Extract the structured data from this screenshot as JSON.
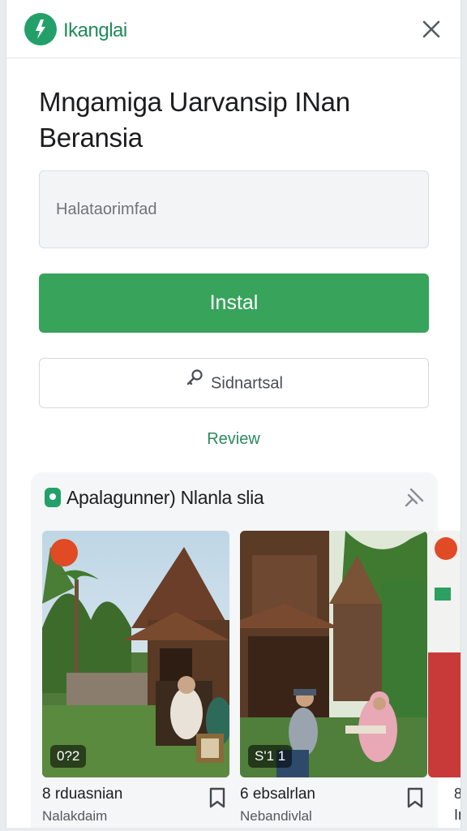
{
  "header": {
    "brand": "Ikanglai",
    "logo_icon": "brand-logo-icon",
    "close_icon": "close-icon"
  },
  "title": {
    "line1": "Mngamiga Uarvansip INan",
    "line2": "Beransia"
  },
  "search": {
    "placeholder": "Halataorimfad"
  },
  "actions": {
    "install_label": "Instal",
    "secondary_label": "Sidnartsal",
    "secondary_icon": "key-icon",
    "review_label": "Review"
  },
  "card": {
    "title": "Apalagunner) Nlanla slia",
    "pin_icon": "pin-icon",
    "videos": [
      {
        "duration": "0?2",
        "title": "8 rduasnian",
        "subtitle": "Nalakdaim"
      },
      {
        "duration": "S'1 1",
        "title": "6 ebsalrlan",
        "subtitle": "Nebandivlal"
      }
    ],
    "peek_title": "8",
    "peek_subtitle": "In"
  },
  "colors": {
    "brand_green": "#23a06a",
    "install_green": "#37a35b",
    "review_green": "#2b8a5e",
    "badge_orange": "#e04a25"
  }
}
